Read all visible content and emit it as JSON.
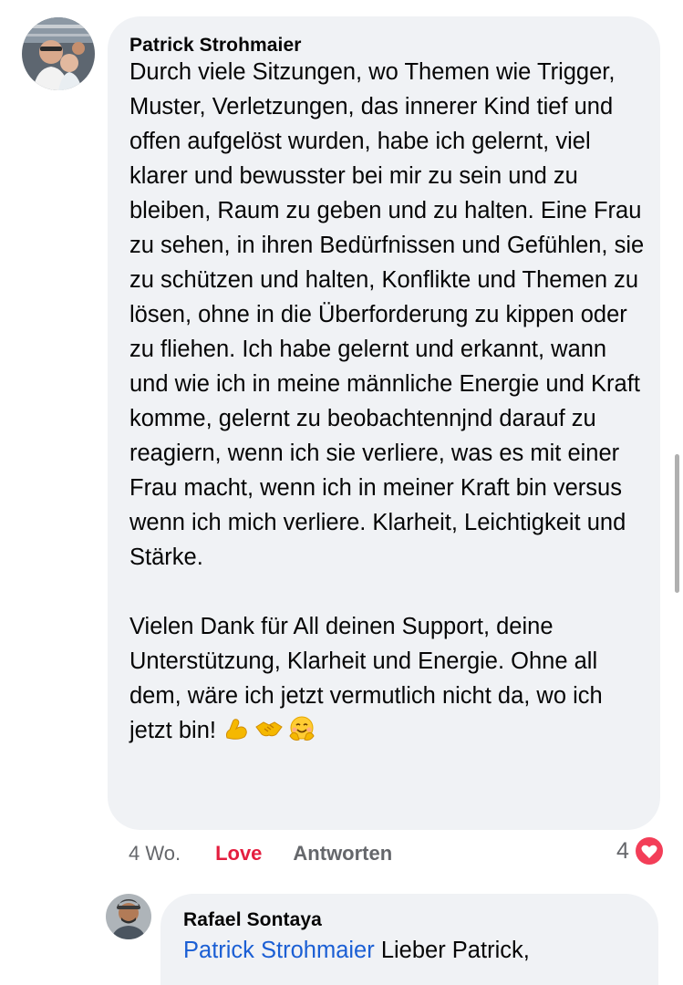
{
  "comment": {
    "author": "Patrick Strohmaier",
    "paragraphs": [
      "Durch viele Sitzungen, wo Themen wie Trigger, Muster, Verletzungen, das innerer Kind tief und offen aufgelöst wurden, habe ich gelernt, viel klarer und bewusster bei mir zu sein und zu bleiben, Raum zu geben und zu halten. Eine Frau zu sehen, in ihren Bedürfnissen und Gefühlen, sie zu schützen und halten, Konflikte und Themen zu lösen, ohne in die Überforderung zu kippen oder zu fliehen. Ich habe gelernt und erkannt, wann und wie ich in meine männliche Energie und Kraft komme, gelernt zu beobachtennjnd darauf zu reagiern, wenn ich sie verliere, was es mit einer Frau macht, wenn ich in meiner Kraft bin versus wenn ich mich verliere. Klarheit, Leichtigkeit und Stärke.",
      "Vielen Dank für All deinen Support, deine Unterstützung, Klarheit und Energie. Ohne all dem, wäre ich jetzt vermutlich nicht da, wo ich jetzt bin!"
    ],
    "emojis": [
      "flexed-biceps-icon",
      "handshake-icon",
      "hugging-face-icon"
    ],
    "time": "4 Wo.",
    "love_label": "Love",
    "reply_label": "Antworten",
    "reaction_count": "4",
    "reaction_type": "heart-icon",
    "colors": {
      "love": "#e41e3f",
      "heart": "#f33e58",
      "bubble": "#f0f2f5"
    }
  },
  "reply": {
    "author": "Rafael Sontaya",
    "mention": "Patrick Strohmaier",
    "text": "Lieber Patrick,",
    "colors": {
      "mention": "#1b5fd4"
    }
  }
}
